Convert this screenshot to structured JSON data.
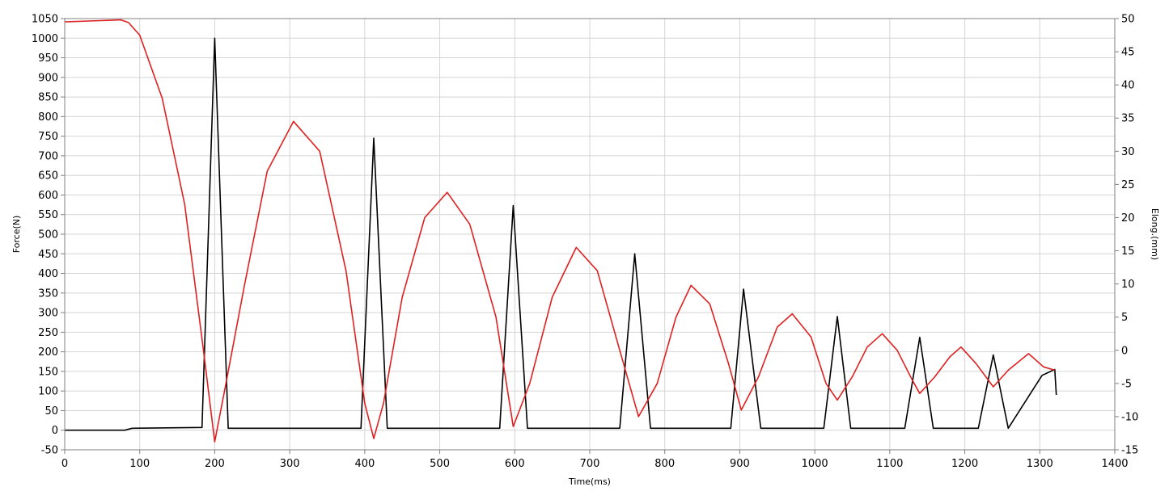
{
  "chart_data": {
    "type": "line",
    "xlabel": "Time(ms)",
    "ylabel": "Force(N)",
    "y2label": "Elong.(mm)",
    "xlim": [
      0,
      1400
    ],
    "ylim": [
      -50,
      1050
    ],
    "y2lim": [
      -15,
      50
    ],
    "xticks": [
      0,
      100,
      200,
      300,
      400,
      500,
      600,
      700,
      800,
      900,
      1000,
      1100,
      1200,
      1300,
      1400
    ],
    "yticks": [
      -50,
      0,
      50,
      100,
      150,
      200,
      250,
      300,
      350,
      400,
      450,
      500,
      550,
      600,
      650,
      700,
      750,
      800,
      850,
      900,
      950,
      1000,
      1050
    ],
    "y2ticks": [
      -15,
      -10,
      -5,
      0,
      5,
      10,
      15,
      20,
      25,
      30,
      35,
      40,
      45,
      50
    ],
    "grid": true,
    "legend": "none",
    "colors": {
      "force": "#000000",
      "elongation": "#e02020",
      "grid": "#d4d4d4",
      "frame": "#808080"
    },
    "series": [
      {
        "axis": "left",
        "color": "#000000",
        "points": [
          [
            0,
            0
          ],
          [
            80,
            0
          ],
          [
            90,
            5
          ],
          [
            183,
            7
          ],
          [
            200,
            1000
          ],
          [
            218,
            5
          ],
          [
            395,
            5
          ],
          [
            412,
            745
          ],
          [
            430,
            5
          ],
          [
            580,
            5
          ],
          [
            598,
            573
          ],
          [
            617,
            5
          ],
          [
            740,
            5
          ],
          [
            760,
            450
          ],
          [
            781,
            5
          ],
          [
            888,
            5
          ],
          [
            905,
            360
          ],
          [
            928,
            5
          ],
          [
            1012,
            5
          ],
          [
            1030,
            290
          ],
          [
            1048,
            5
          ],
          [
            1120,
            5
          ],
          [
            1140,
            237
          ],
          [
            1158,
            5
          ],
          [
            1218,
            5
          ],
          [
            1238,
            192
          ],
          [
            1258,
            5
          ],
          [
            1303,
            140
          ],
          [
            1320,
            155
          ],
          [
            1322,
            90
          ]
        ]
      },
      {
        "axis": "right",
        "color": "#e02020",
        "points": [
          [
            0,
            49.5
          ],
          [
            75,
            49.8
          ],
          [
            85,
            49.4
          ],
          [
            100,
            47.5
          ],
          [
            130,
            38
          ],
          [
            160,
            22
          ],
          [
            185,
            0
          ],
          [
            200,
            -13.8
          ],
          [
            215,
            -5
          ],
          [
            240,
            10
          ],
          [
            270,
            27
          ],
          [
            305,
            34.5
          ],
          [
            340,
            30
          ],
          [
            375,
            12
          ],
          [
            400,
            -8
          ],
          [
            412,
            -13.3
          ],
          [
            425,
            -8
          ],
          [
            450,
            8
          ],
          [
            480,
            20
          ],
          [
            510,
            23.8
          ],
          [
            540,
            19
          ],
          [
            575,
            5
          ],
          [
            598,
            -11.5
          ],
          [
            620,
            -5
          ],
          [
            650,
            8
          ],
          [
            682,
            15.5
          ],
          [
            710,
            12
          ],
          [
            740,
            0
          ],
          [
            765,
            -10
          ],
          [
            790,
            -5
          ],
          [
            815,
            5
          ],
          [
            835,
            9.8
          ],
          [
            860,
            7
          ],
          [
            885,
            -2
          ],
          [
            902,
            -9
          ],
          [
            925,
            -4
          ],
          [
            950,
            3.5
          ],
          [
            970,
            5.5
          ],
          [
            995,
            2
          ],
          [
            1015,
            -5
          ],
          [
            1030,
            -7.5
          ],
          [
            1050,
            -4
          ],
          [
            1070,
            0.5
          ],
          [
            1090,
            2.5
          ],
          [
            1110,
            0
          ],
          [
            1130,
            -4.5
          ],
          [
            1140,
            -6.5
          ],
          [
            1160,
            -4
          ],
          [
            1180,
            -1
          ],
          [
            1195,
            0.5
          ],
          [
            1215,
            -2
          ],
          [
            1238,
            -5.5
          ],
          [
            1258,
            -3
          ],
          [
            1285,
            -0.5
          ],
          [
            1305,
            -2.5
          ],
          [
            1320,
            -3
          ]
        ]
      }
    ]
  }
}
